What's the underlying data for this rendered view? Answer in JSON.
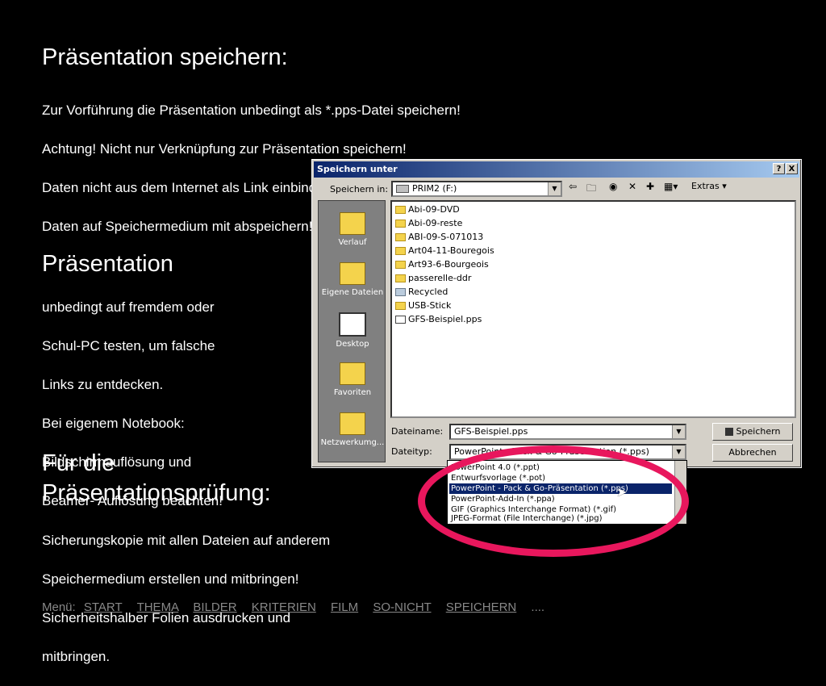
{
  "sections": [
    {
      "heading": "Präsentation speichern:",
      "lines": [
        "Zur Vorführung die Präsentation unbedingt als *.pps-Datei speichern!",
        "Achtung! Nicht nur Verknüpfung zur Präsentation speichern!",
        "Daten nicht aus dem Internet als Link einbinden!",
        "Daten auf Speichermedium mit abspeichern!"
      ]
    },
    {
      "heading": "Präsentation",
      "lines": [
        "unbedingt auf fremdem oder",
        "Schul-PC testen, um falsche",
        "Links zu entdecken.",
        "Bei eigenem Notebook:",
        "Bildschirmauflösung und",
        "Beamer- Auflösung beachten!"
      ]
    },
    {
      "heading_line1": "Für die",
      "heading_line2": "Präsentationsprüfung:",
      "lines": [
        "Sicherungskopie mit allen Dateien auf anderem",
        "Speichermedium erstellen und mitbringen!",
        "Sicherheitshalber Folien ausdrucken und",
        "mitbringen."
      ]
    }
  ],
  "dialog": {
    "title": "Speichern unter",
    "help_btn": "?",
    "close_btn": "X",
    "save_in_label": "Speichern in:",
    "save_in_value": "PRIM2 (F:)",
    "extras_label": "Extras",
    "places": [
      "Verlauf",
      "Eigene Dateien",
      "Desktop",
      "Favoriten",
      "Netzwerkumg..."
    ],
    "files": [
      "Abi-09-DVD",
      "Abi-09-reste",
      "ABI-09-S-071013",
      "Art04-11-Bouregois",
      "Art93-6-Bourgeois",
      "passerelle-ddr",
      "Recycled",
      "USB-Stick",
      "GFS-Beispiel.pps"
    ],
    "filename_label": "Dateiname:",
    "filename_value": "GFS-Beispiel.pps",
    "filetype_label": "Dateityp:",
    "filetype_value": "PowerPoint - Pack & Go-Präsentation (*.pps)",
    "save_button": "Speichern",
    "cancel_button": "Abbrechen",
    "type_options": [
      "PowerPoint 4.0 (*.ppt)",
      "Entwurfsvorlage (*.pot)",
      "PowerPoint - Pack & Go-Präsentation (*.pps)",
      "PowerPoint-Add-In (*.ppa)",
      "GIF (Graphics Interchange Format) (*.gif)",
      "JPEG-Format (File Interchange) (*.jpg)"
    ],
    "selected_option_index": 2
  },
  "menu": {
    "label": "Menü:",
    "items": [
      "START",
      "THEMA",
      "BILDER",
      "KRITERIEN",
      "FILM",
      "SO-NICHT",
      "SPEICHERN"
    ],
    "more": "...."
  },
  "colors": {
    "highlight_ellipse": "#e8175d",
    "title_bar": "#0a246a"
  }
}
